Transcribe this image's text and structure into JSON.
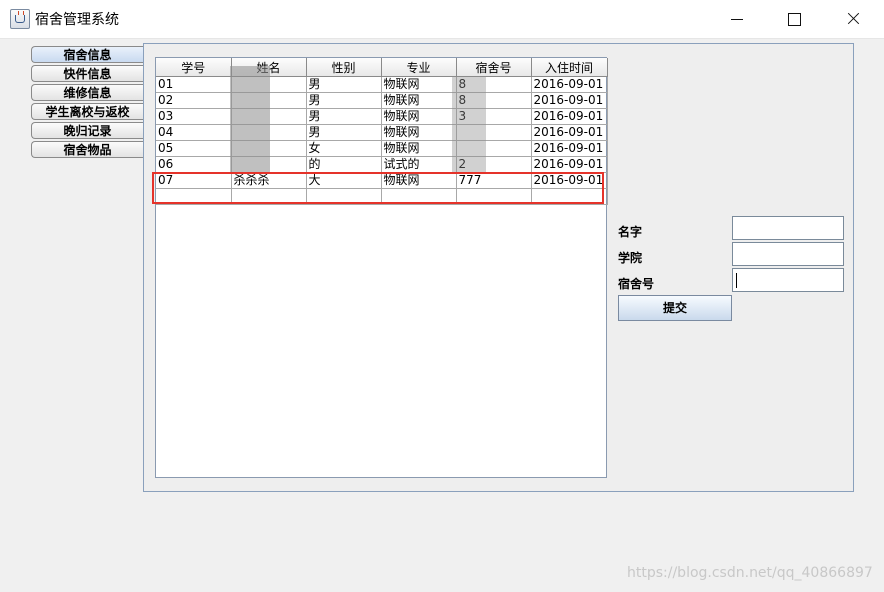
{
  "window": {
    "title": "宿舍管理系统"
  },
  "tabs": [
    {
      "label": "宿舍信息"
    },
    {
      "label": "快件信息"
    },
    {
      "label": "维修信息"
    },
    {
      "label": "学生离校与返校"
    },
    {
      "label": "晚归记录"
    },
    {
      "label": "宿舍物品"
    }
  ],
  "table": {
    "columns": [
      "学号",
      "姓名",
      "性别",
      "专业",
      "宿舍号",
      "入住时间"
    ],
    "rows": [
      [
        "01",
        "",
        "男",
        "物联网",
        "8",
        "2016-09-01"
      ],
      [
        "02",
        "",
        "男",
        "物联网",
        "8",
        "2016-09-01"
      ],
      [
        "03",
        "",
        "男",
        "物联网",
        "3",
        "2016-09-01"
      ],
      [
        "04",
        "",
        "男",
        "物联网",
        "",
        "2016-09-01"
      ],
      [
        "05",
        "",
        "女",
        "物联网",
        "",
        "2016-09-01"
      ],
      [
        "06",
        "",
        "的",
        "试式的",
        "2",
        "2016-09-01"
      ],
      [
        "07",
        "杀杀杀",
        "大",
        "物联网",
        "777",
        "2016-09-01"
      ],
      [
        "",
        "",
        "",
        "",
        "",
        ""
      ]
    ]
  },
  "form": {
    "name_label": "名字",
    "college_label": "学院",
    "dorm_label": "宿舍号",
    "submit_label": "提交"
  },
  "watermark": "https://blog.csdn.net/qq_40866897"
}
